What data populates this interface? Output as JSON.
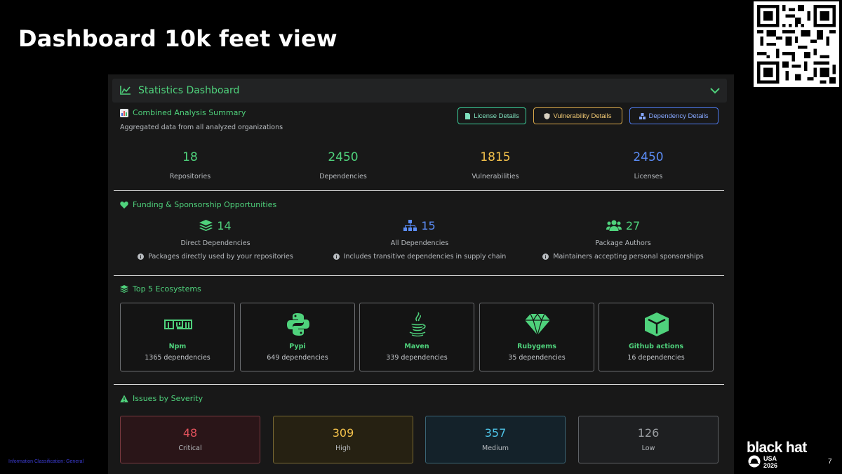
{
  "slide": {
    "title": "Dashboard 10k feet view",
    "classification": "Information Classification: General",
    "page_number": "7"
  },
  "brand": {
    "name": "black hat",
    "event_line1": "USA",
    "event_line2": "2026"
  },
  "dashboard": {
    "title": "Statistics Dashboard",
    "summary": {
      "title": "Combined Analysis Summary",
      "subtitle": "Aggregated data from all analyzed organizations",
      "buttons": {
        "license": "License Details",
        "vulnerability": "Vulnerability Details",
        "dependency": "Dependency Details"
      },
      "stats": [
        {
          "value": "18",
          "label": "Repositories",
          "color": "#4fd27c"
        },
        {
          "value": "2450",
          "label": "Dependencies",
          "color": "#4fd27c"
        },
        {
          "value": "1815",
          "label": "Vulnerabilities",
          "color": "#f3c14b"
        },
        {
          "value": "2450",
          "label": "Licenses",
          "color": "#5b8cf5"
        }
      ]
    },
    "funding": {
      "title": "Funding & Sponsorship Opportunities",
      "items": [
        {
          "value": "14",
          "label": "Direct Dependencies",
          "note": "Packages directly used by your repositories",
          "color": "#4fd27c"
        },
        {
          "value": "15",
          "label": "All Dependencies",
          "note": "Includes transitive dependencies in supply chain",
          "color": "#5b8cf5"
        },
        {
          "value": "27",
          "label": "Package Authors",
          "note": "Maintainers accepting personal sponsorships",
          "color": "#4fd27c"
        }
      ]
    },
    "ecosystems": {
      "title": "Top 5 Ecosystems",
      "items": [
        {
          "name": "Npm",
          "count": "1365 dependencies",
          "icon": "npm-icon"
        },
        {
          "name": "Pypi",
          "count": "649 dependencies",
          "icon": "python-icon"
        },
        {
          "name": "Maven",
          "count": "339 dependencies",
          "icon": "java-icon"
        },
        {
          "name": "Rubygems",
          "count": "35 dependencies",
          "icon": "gem-icon"
        },
        {
          "name": "Github actions",
          "count": "16 dependencies",
          "icon": "cube-icon"
        }
      ]
    },
    "severity": {
      "title": "Issues by Severity",
      "items": [
        {
          "value": "48",
          "label": "Critical",
          "color": "#e2525c"
        },
        {
          "value": "309",
          "label": "High",
          "color": "#f3c14b"
        },
        {
          "value": "357",
          "label": "Medium",
          "color": "#4ec4e8"
        },
        {
          "value": "126",
          "label": "Low",
          "color": "#9a9da1"
        }
      ]
    }
  }
}
